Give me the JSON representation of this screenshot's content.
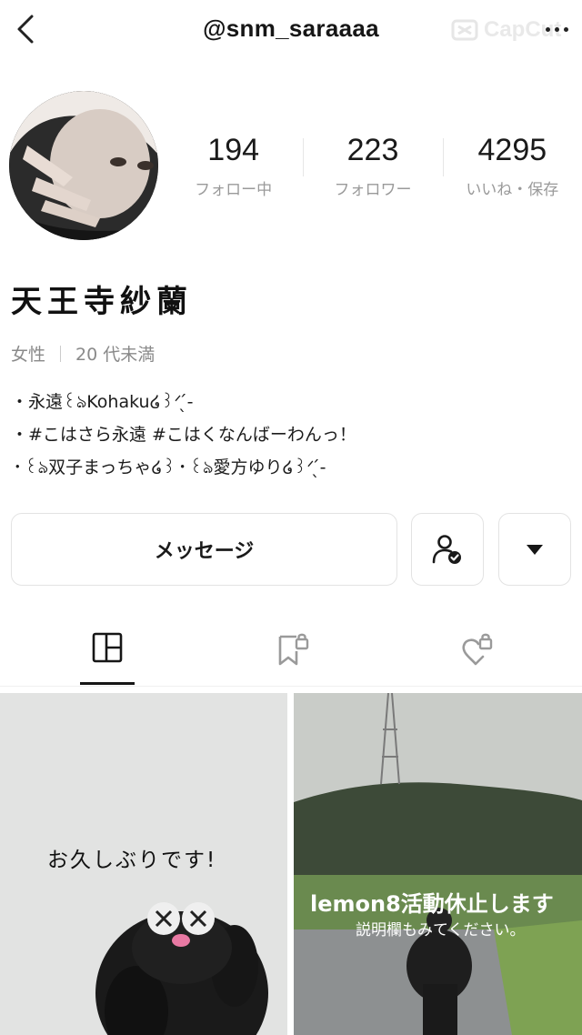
{
  "header": {
    "username": "@snm_saraaaa",
    "watermark_text": "CapCut",
    "back_icon": "chevron-left-icon",
    "more_icon": "more-horizontal-icon"
  },
  "profile": {
    "display_name": "天王寺紗蘭",
    "gender": "女性",
    "age_group": "20 代未満",
    "bio": [
      "・永遠꒰ঌKohaku໒꒱ᐟ‪‪ ̖́-",
      "・#こはさら永遠 #こはくなんばーわんっ！",
      "・꒰ঌ双子まっちゃ໒꒱・꒰ঌ愛方ゆり໒꒱ᐟ‪‪ ̖́-"
    ]
  },
  "stats": [
    {
      "value": "194",
      "label": "フォロー中"
    },
    {
      "value": "223",
      "label": "フォロワー"
    },
    {
      "value": "4295",
      "label": "いいね・保存"
    }
  ],
  "actions": {
    "message_label": "メッセージ",
    "follow_status_icon": "user-check-icon",
    "expand_icon": "caret-down-icon"
  },
  "tabs": [
    {
      "name": "posts",
      "icon": "layout-grid-icon",
      "active": true
    },
    {
      "name": "saved",
      "icon": "bookmark-lock-icon",
      "active": false
    },
    {
      "name": "liked",
      "icon": "heart-lock-icon",
      "active": false
    }
  ],
  "posts": [
    {
      "overlay_text": "お久しぶりです!"
    },
    {
      "overlay_text": "lemon8活動休止します",
      "overlay_subtext": "説明欄もみてください。"
    }
  ],
  "colors": {
    "text_primary": "#161616",
    "text_secondary": "#9a9a9a",
    "border": "#e3e3e3",
    "verify_badge": "#1a1a1a"
  }
}
